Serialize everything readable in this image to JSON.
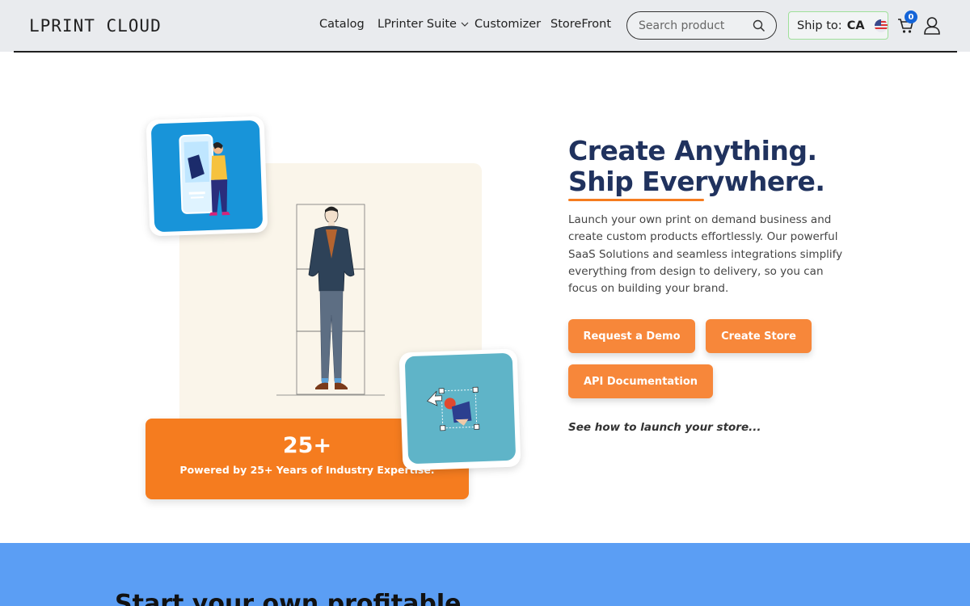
{
  "header": {
    "logo": "LPRINT CLOUD",
    "nav": {
      "catalog": "Catalog",
      "suite": "LPrinter Suite",
      "customizer": "Customizer",
      "storefront": "StoreFront"
    },
    "search": {
      "placeholder": "Search product"
    },
    "ship": {
      "label": "Ship to:",
      "code": "CA"
    },
    "cart_count": "0"
  },
  "hero": {
    "headline_line1": "Create Anything.",
    "headline_line2": "Ship Everywhere.",
    "description": "Launch your own print on demand business and create custom products effortlessly. Our powerful SaaS Solutions and seamless integrations simplify everything from design to delivery, so you can focus on building your brand.",
    "buttons": {
      "demo": "Request a Demo",
      "store": "Create Store",
      "api": "API Documentation"
    },
    "see_how": "See how to launch your store...",
    "stat_value": "25+",
    "stat_caption": "Powered by 25+ Years of Industry Expertise."
  },
  "section2": {
    "title": "Start your own profitable"
  },
  "colors": {
    "accent_orange": "#f57c1f",
    "heading_navy": "#20325e",
    "section_blue": "#5b9ef4"
  }
}
